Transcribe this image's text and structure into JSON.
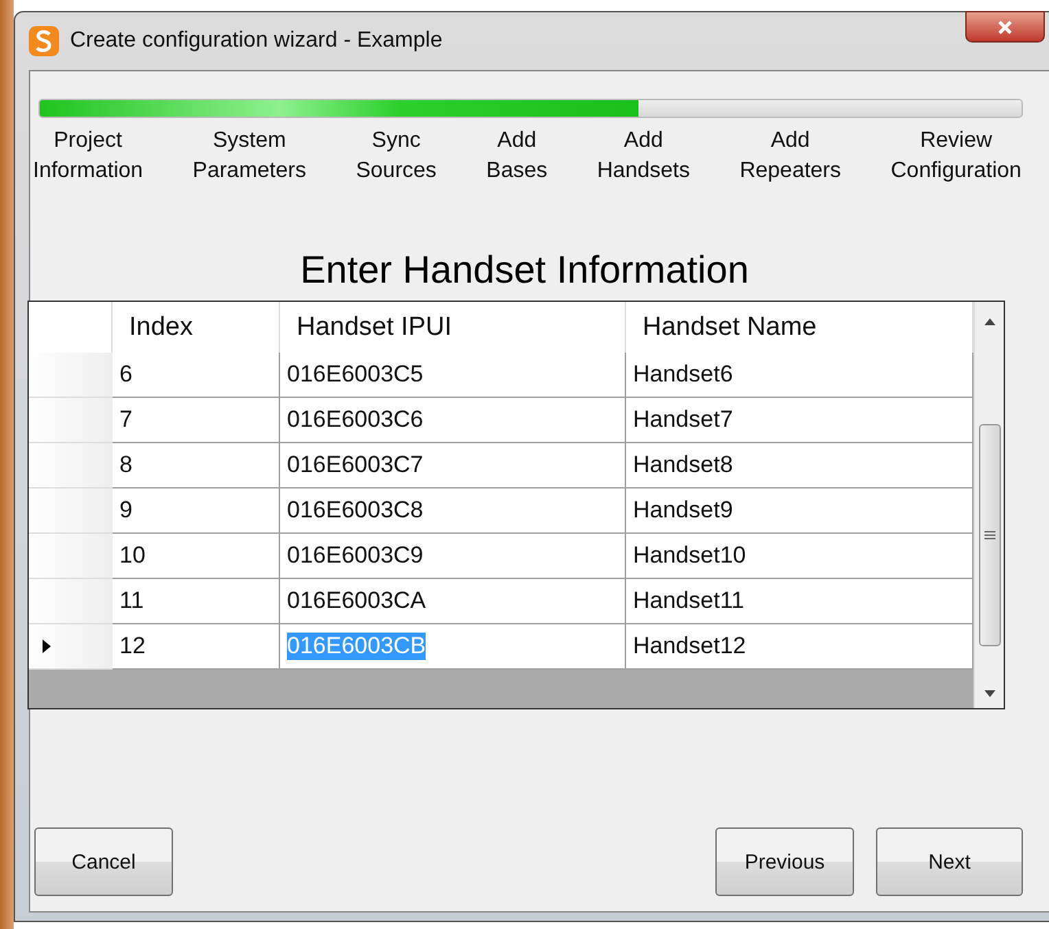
{
  "window": {
    "title": "Create configuration wizard - Example"
  },
  "progress": {
    "level": 0.61
  },
  "steps": [
    {
      "label": "Project Information"
    },
    {
      "label": "System Parameters"
    },
    {
      "label": "Sync Sources"
    },
    {
      "label": "Add Bases"
    },
    {
      "label": "Add Handsets"
    },
    {
      "label": "Add Repeaters"
    },
    {
      "label": "Review Configuration"
    }
  ],
  "heading": "Enter Handset Information",
  "table": {
    "columns": [
      "Index",
      "Handset IPUI",
      "Handset Name"
    ],
    "rows": [
      {
        "index": "6",
        "ipui": "016E6003C5",
        "name": "Handset6",
        "selected": false
      },
      {
        "index": "7",
        "ipui": "016E6003C6",
        "name": "Handset7",
        "selected": false
      },
      {
        "index": "8",
        "ipui": "016E6003C7",
        "name": "Handset8",
        "selected": false
      },
      {
        "index": "9",
        "ipui": "016E6003C8",
        "name": "Handset9",
        "selected": false
      },
      {
        "index": "10",
        "ipui": "016E6003C9",
        "name": "Handset10",
        "selected": false
      },
      {
        "index": "11",
        "ipui": "016E6003CA",
        "name": "Handset11",
        "selected": false
      },
      {
        "index": "12",
        "ipui": "016E6003CB",
        "name": "Handset12",
        "selected": true
      }
    ]
  },
  "buttons": {
    "cancel": "Cancel",
    "previous": "Previous",
    "next": "Next"
  }
}
